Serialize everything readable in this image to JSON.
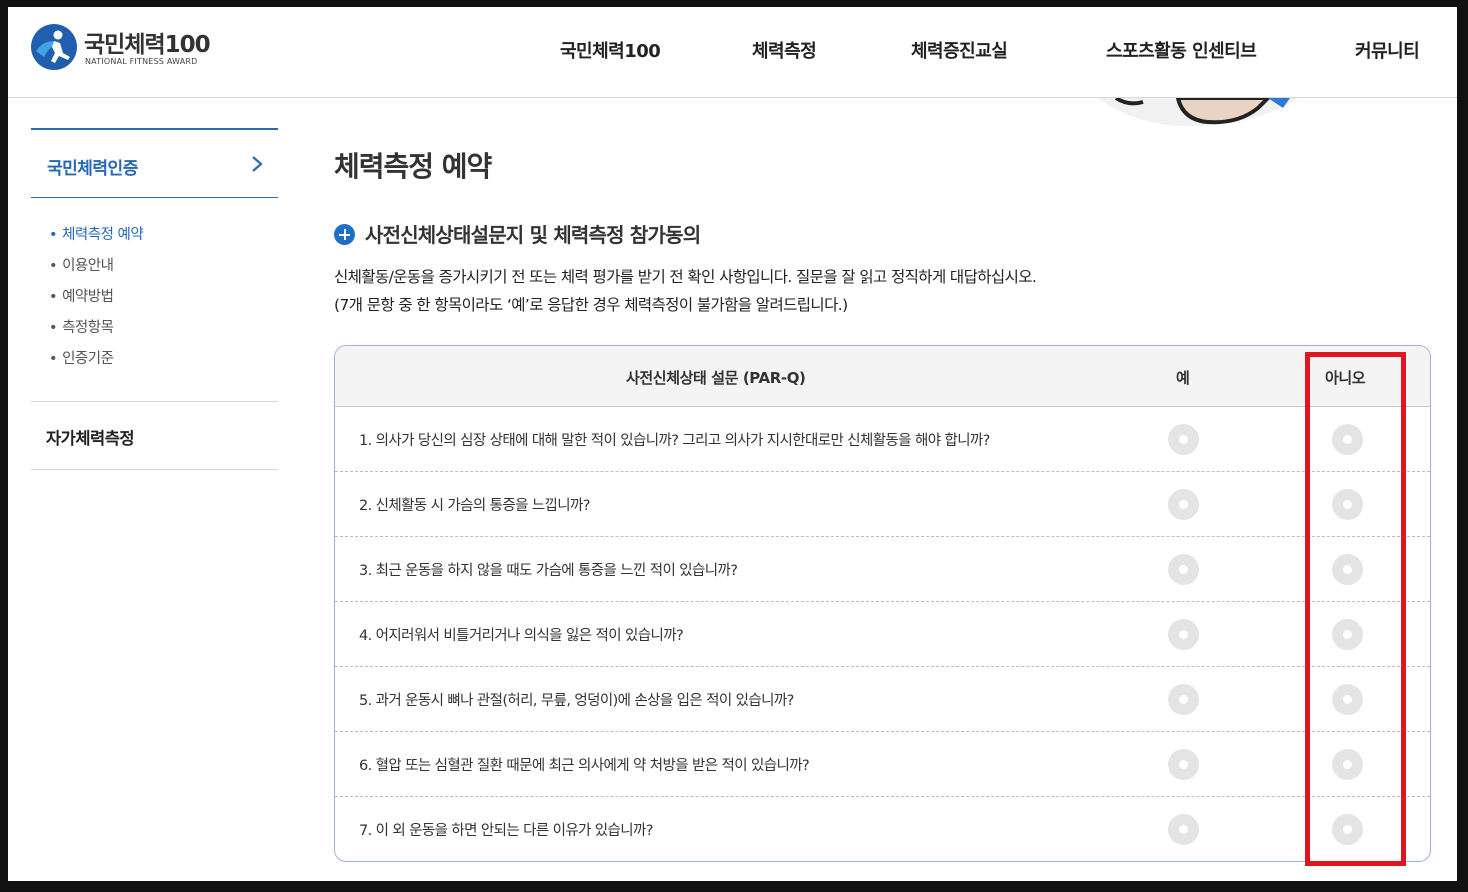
{
  "header": {
    "logo_title": "국민체력100",
    "logo_subtitle": "NATIONAL FITNESS AWARD",
    "nav": [
      "국민체력100",
      "체력측정",
      "체력증진교실",
      "스포츠활동 인센티브",
      "커뮤니티"
    ]
  },
  "sidebar": {
    "top_label": "국민체력인증",
    "sub_items": [
      "체력측정 예약",
      "이용안내",
      "예약방법",
      "측정항목",
      "인증기준"
    ],
    "active_index": 0,
    "bottom_label": "자가체력측정"
  },
  "main": {
    "page_title": "체력측정 예약",
    "section_title": "사전신체상태설문지 및 체력측정 참가동의",
    "desc_line1": "신체활동/운동을 증가시키기 전 또는 체력 평가를 받기 전 확인 사항입니다. 질문을 잘 읽고 정직하게 대답하십시오.",
    "desc_line2": "(7개 문항 중 한 항목이라도 ‘예’로 응답한 경우 체력측정이 불가함을 알려드립니다.)"
  },
  "table": {
    "header_question": "사전신체상태 설문 (PAR-Q)",
    "header_yes": "예",
    "header_no": "아니오",
    "questions": [
      "1. 의사가 당신의 심장 상태에 대해 말한 적이 있습니까? 그리고 의사가 지시한대로만 신체활동을 해야 합니까?",
      "2. 신체활동 시 가슴의 통증을 느낍니까?",
      "3. 최근 운동을 하지 않을 때도 가슴에 통증을 느낀 적이 있습니까?",
      "4. 어지러워서 비틀거리거나 의식을 잃은 적이 있습니까?",
      "5. 과거 운동시 뼈나 관절(허리, 무릎, 엉덩이)에 손상을 입은 적이 있습니까?",
      "6. 혈압 또는 심혈관 질환 때문에 최근 의사에게 약 처방을 받은 적이 있습니까?",
      "7. 이 외 운동을 하면 안되는 다른 이유가 있습니까?"
    ]
  },
  "colors": {
    "accent": "#2668b8",
    "highlight": "#e0161e"
  }
}
